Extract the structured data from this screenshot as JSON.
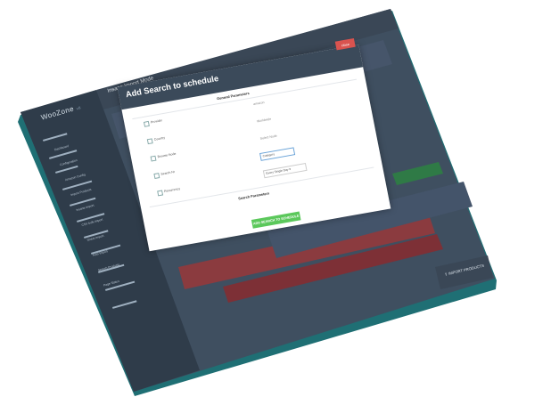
{
  "app": {
    "logo": "WooZone",
    "logo_version": "v8",
    "page_title": "Insane Import Mode"
  },
  "sidebar": {
    "items": [
      {
        "label": "Dashboard"
      },
      {
        "label": "Configuration"
      },
      {
        "label": "Amazon Config"
      },
      {
        "label": "Import Products"
      },
      {
        "label": "Insane Import"
      },
      {
        "label": "CSV bulk import"
      },
      {
        "label": "Direct Import"
      },
      {
        "label": "Auto Import"
      },
      {
        "label": "Search Products"
      },
      {
        "label": "Page Status"
      }
    ]
  },
  "modal": {
    "title": "Add Search to schedule",
    "close_label": "close",
    "general_section": "General Parameters",
    "search_section": "Search Parameters",
    "rows": [
      {
        "label": "Provider",
        "value": "amazon"
      },
      {
        "label": "Country",
        "value": "Worldwide"
      },
      {
        "label": "Browse Node",
        "value": "Select Node"
      },
      {
        "label": "Search Nr",
        "value": "Category"
      },
      {
        "label": "Recurrency",
        "value": "Every Single Day"
      }
    ],
    "add_button": "ADD SEARCH TO SCHEDULE"
  },
  "right_panel": {
    "import_button": "IMPORT PRODUCTS"
  },
  "colors": {
    "screen_bg": "#3f4f60",
    "sidebar_bg": "#2e3b49",
    "overlay": "#4a5868",
    "accent_green": "#5bc85b",
    "accent_red": "#d9534f",
    "modal_header": "#3b4a5a"
  }
}
